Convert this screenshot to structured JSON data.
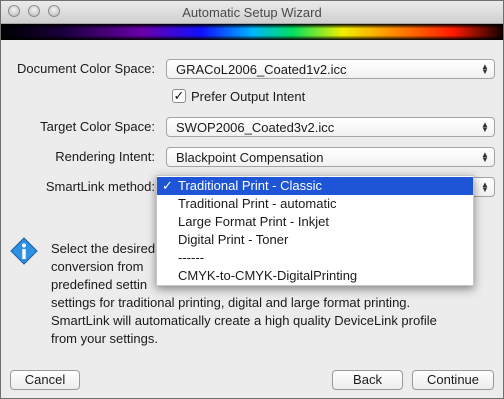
{
  "window": {
    "title": "Automatic Setup Wizard"
  },
  "form": {
    "document_color_space": {
      "label": "Document Color Space:",
      "value": "GRACoL2006_Coated1v2.icc"
    },
    "prefer_output_intent": {
      "label": "Prefer Output Intent",
      "checked": true,
      "check_glyph": "✓"
    },
    "target_color_space": {
      "label": "Target Color Space:",
      "value": "SWOP2006_Coated3v2.icc"
    },
    "rendering_intent": {
      "label": "Rendering Intent:",
      "value": "Blackpoint Compensation"
    },
    "smartlink_method": {
      "label": "SmartLink method:",
      "value": "Traditional Print - Classic",
      "selected_glyph": "✓",
      "options": [
        "Traditional Print - Classic",
        "Traditional Print - automatic",
        "Large Format Print - Inkjet",
        "Digital Print - Toner",
        "------",
        "CMYK-to-CMYK-DigitalPrinting"
      ]
    }
  },
  "description": {
    "icon": "info-icon",
    "line1": "Select the desired",
    "line2": "conversion from",
    "line3": "predefined settin",
    "line4": "settings for traditional printing, digital and large format printing.",
    "line5": "SmartLink will automatically create a high quality DeviceLink profile",
    "line6": "from your settings."
  },
  "buttons": {
    "cancel": "Cancel",
    "back": "Back",
    "continue": "Continue"
  },
  "colors": {
    "selection": "#1e54d6",
    "window_bg": "#ececec"
  }
}
